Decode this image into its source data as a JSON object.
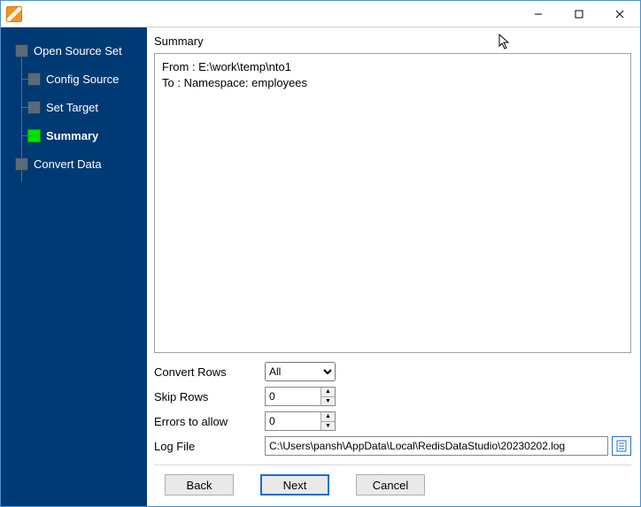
{
  "titlebar": {
    "title": ""
  },
  "sidebar": {
    "steps": [
      {
        "label": "Open Source Set"
      },
      {
        "label": "Config Source"
      },
      {
        "label": "Set Target"
      },
      {
        "label": "Summary"
      },
      {
        "label": "Convert Data"
      }
    ]
  },
  "main": {
    "summary_label": "Summary",
    "summary_text": "From : E:\\work\\temp\\nto1\nTo : Namespace: employees",
    "convert_rows_label": "Convert Rows",
    "convert_rows_value": "All",
    "skip_rows_label": "Skip Rows",
    "skip_rows_value": "0",
    "errors_label": "Errors to allow",
    "errors_value": "0",
    "log_file_label": "Log File",
    "log_file_value": "C:\\Users\\pansh\\AppData\\Local\\RedisDataStudio\\20230202.log"
  },
  "buttons": {
    "back": "Back",
    "next": "Next",
    "cancel": "Cancel"
  }
}
